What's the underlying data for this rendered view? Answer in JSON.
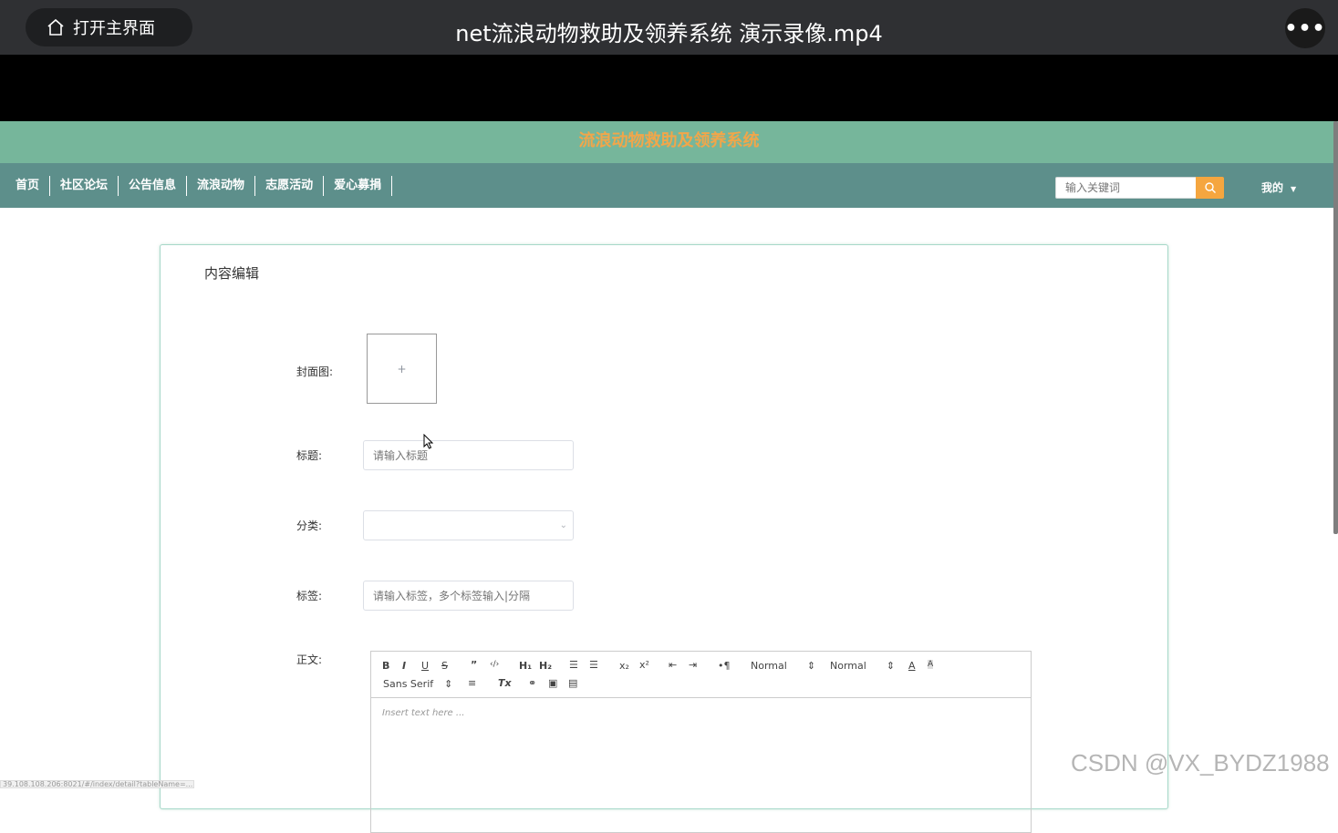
{
  "player": {
    "home_label": "打开主界面",
    "video_title": "net流浪动物救助及领养系统 演示录像.mp4",
    "more_label": "•••"
  },
  "site": {
    "title": "流浪动物救助及领养系统",
    "nav": [
      "首页",
      "社区论坛",
      "公告信息",
      "流浪动物",
      "志愿活动",
      "爱心募捐"
    ],
    "search_placeholder": "输入关键词",
    "my_label": "我的"
  },
  "form": {
    "card_title": "内容编辑",
    "cover_label": "封面图:",
    "upload_plus": "+",
    "title_label": "标题:",
    "title_placeholder": "请输入标题",
    "category_label": "分类:",
    "category_value": "",
    "tags_label": "标签:",
    "tags_placeholder": "请输入标签，多个标签输入|分隔",
    "body_label": "正文:"
  },
  "editor": {
    "bold": "B",
    "italic": "I",
    "underline": "U",
    "strike": "S",
    "quote": "”",
    "code": "‹/›",
    "h1": "H₁",
    "h2": "H₂",
    "sub": "x₂",
    "sup": "x²",
    "rtl": "•¶",
    "size_select": "Normal",
    "header_select": "Normal",
    "font_select": "Sans Serif",
    "clean": "Tx",
    "color_a": "A",
    "background_a": "A",
    "placeholder": "Insert text here ..."
  },
  "overlay": {
    "watermark": "CSDN @VX_BYDZ1988",
    "status_url": "39.108.108.206:8021/#/index/detail?tableName=..."
  }
}
